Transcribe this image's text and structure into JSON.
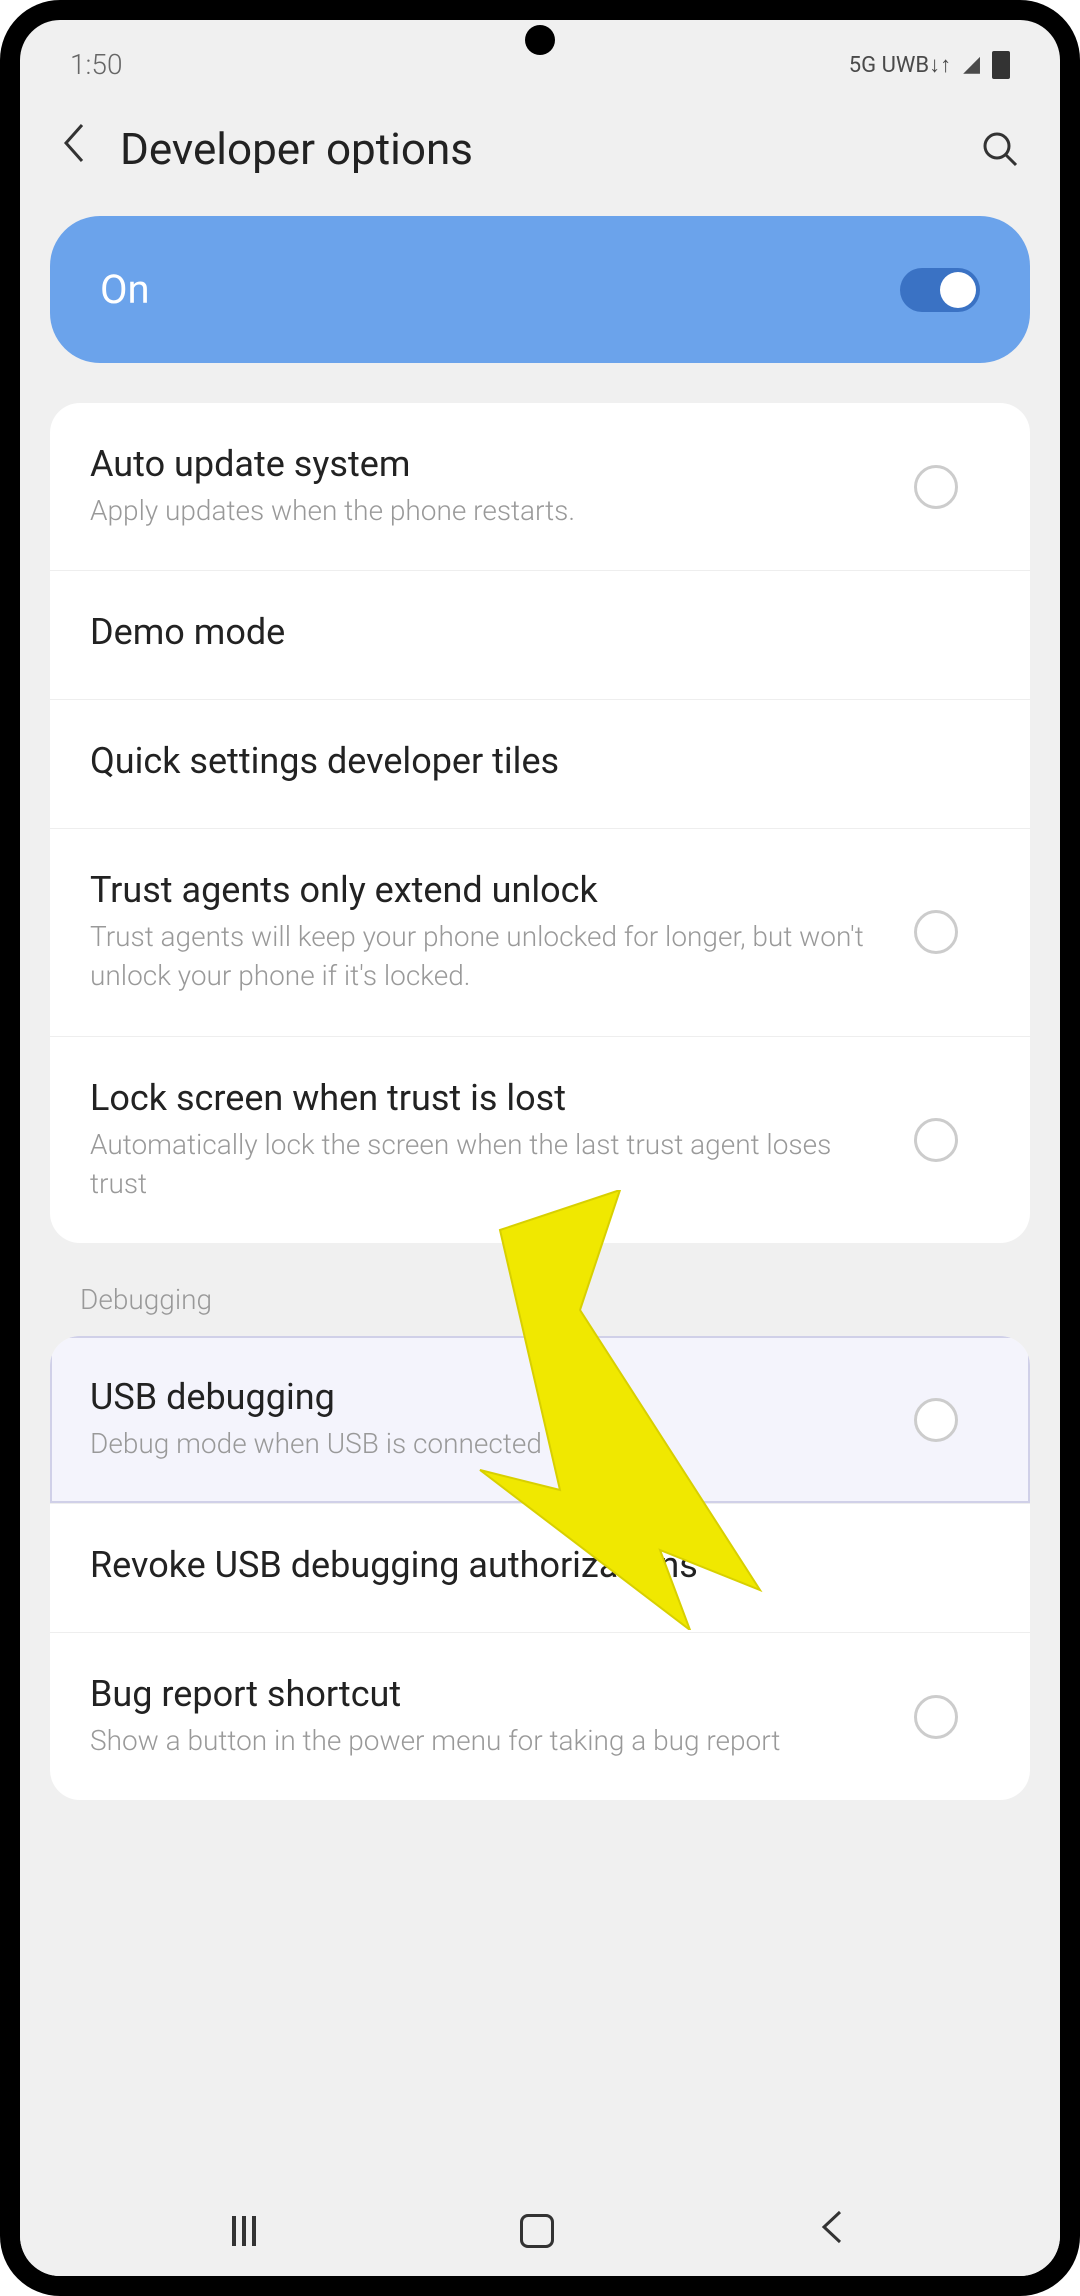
{
  "statusBar": {
    "time": "1:50",
    "network": "5G UWB↓↑"
  },
  "header": {
    "title": "Developer options"
  },
  "masterToggle": {
    "label": "On",
    "state": "on"
  },
  "settings": {
    "group1": [
      {
        "title": "Auto update system",
        "subtitle": "Apply updates when the phone restarts.",
        "hasToggle": true
      },
      {
        "title": "Demo mode",
        "subtitle": "",
        "hasToggle": false
      },
      {
        "title": "Quick settings developer tiles",
        "subtitle": "",
        "hasToggle": false
      },
      {
        "title": "Trust agents only extend unlock",
        "subtitle": "Trust agents will keep your phone unlocked for longer, but won't unlock your phone if it's locked.",
        "hasToggle": true
      },
      {
        "title": "Lock screen when trust is lost",
        "subtitle": "Automatically lock the screen when the last trust agent loses trust",
        "hasToggle": true
      }
    ],
    "sectionLabel": "Debugging",
    "group2": [
      {
        "title": "USB debugging",
        "subtitle": "Debug mode when USB is connected",
        "hasToggle": true,
        "highlighted": true
      },
      {
        "title": "Revoke USB debugging authorizations",
        "subtitle": "",
        "hasToggle": false
      },
      {
        "title": "Bug report shortcut",
        "subtitle": "Show a button in the power menu for taking a bug report",
        "hasToggle": true
      }
    ]
  }
}
